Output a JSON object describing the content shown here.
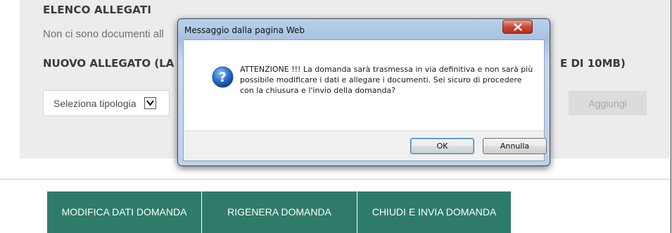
{
  "page": {
    "section_title": "ELENCO ALLEGATI",
    "no_documents_text": "Non ci sono documenti all",
    "new_attachment_heading": "NUOVO ALLEGATO (LA DI",
    "new_attachment_heading_tail": "E DI 10MB)",
    "type_select_label": "Seleziona tipologia",
    "add_button_label": "Aggiungi",
    "actions": [
      {
        "label": "MODIFICA DATI DOMANDA"
      },
      {
        "label": "RIGENERA DOMANDA"
      },
      {
        "label": "CHIUDI E INVIA DOMANDA"
      }
    ]
  },
  "dialog": {
    "title": "Messaggio dalla pagina Web",
    "icon": "question-icon",
    "message": "ATTENZIONE !!! La domanda sarà trasmessa in via definitiva e non sarà più possibile modificare i dati e allegare i documenti. Sei sicuro di procedere con la chiusura e l'invio della domanda?",
    "ok_label": "OK",
    "cancel_label": "Annulla"
  },
  "colors": {
    "action_green": "#2e7b69",
    "panel_gray": "#ececec",
    "close_red": "#c84a33"
  }
}
